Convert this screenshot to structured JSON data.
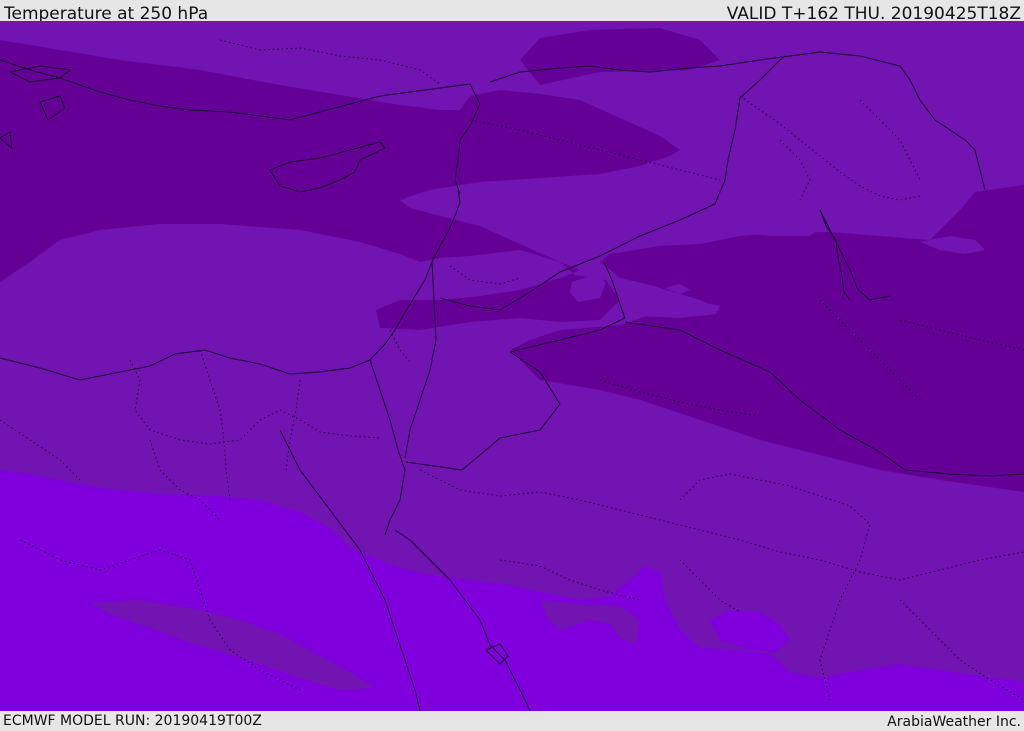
{
  "header": {
    "title": "Temperature at 250 hPa",
    "valid": "VALID T+162 THU. 20190425T18Z"
  },
  "footer": {
    "model_run": "ECMWF MODEL RUN: 20190419T00Z",
    "credit": "ArabiaWeather Inc."
  },
  "colors": {
    "band_cold": "#650096",
    "band_mid": "#7214b2",
    "band_warm": "#7f00dd",
    "coastline": "#1a0033",
    "bars": "#e6e6e6"
  }
}
